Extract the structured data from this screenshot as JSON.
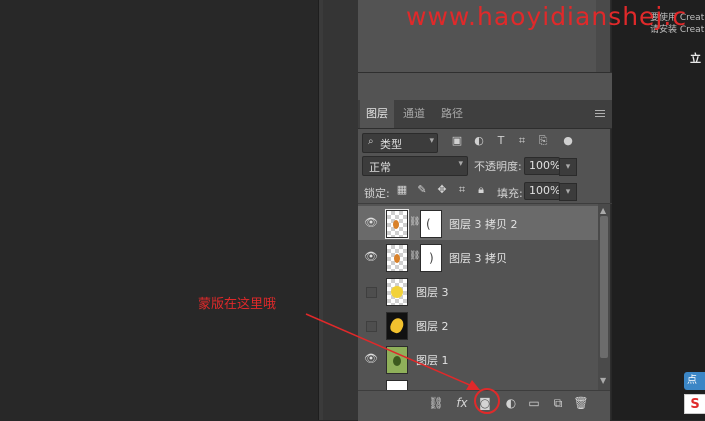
{
  "watermark": "www.haoyidianshej.c",
  "right_panel": {
    "line1": "要使用 Creat",
    "line2": "请安装 Creat",
    "line3": "立"
  },
  "layers_panel": {
    "tabs": [
      "图层",
      "通道",
      "路径"
    ],
    "filter": {
      "kind_label": "类型",
      "search_icon": "⌕"
    },
    "filter_icons": [
      "image-filter-icon",
      "adjustment-filter-icon",
      "type-filter-icon",
      "shape-filter-icon",
      "smart-object-filter-icon",
      "filter-toggle-icon"
    ],
    "blend_mode": "正常",
    "opacity_label": "不透明度:",
    "opacity_value": "100%",
    "lock_label": "锁定:",
    "lock_icons": [
      "lock-transparent-icon",
      "lock-paint-icon",
      "lock-move-icon",
      "lock-artboard-icon",
      "lock-all-icon"
    ],
    "fill_label": "填充:",
    "fill_value": "100%",
    "layers": [
      {
        "name": "图层 3 拷贝 2",
        "visible": true,
        "selected": true,
        "has_mask": true
      },
      {
        "name": "图层 3 拷贝",
        "visible": true,
        "selected": false,
        "has_mask": true
      },
      {
        "name": "图层 3",
        "visible": false,
        "selected": false,
        "has_mask": false
      },
      {
        "name": "图层 2",
        "visible": false,
        "selected": false,
        "has_mask": false
      },
      {
        "name": "图层 1",
        "visible": true,
        "selected": false,
        "has_mask": false
      }
    ],
    "bottom_icons": [
      "link-layers-icon",
      "fx-icon",
      "add-mask-icon",
      "adjustment-layer-icon",
      "group-folder-icon",
      "new-layer-icon",
      "delete-layer-icon"
    ]
  },
  "annotation": "蒙版在这里哦",
  "widgets": {
    "tip": "点",
    "sogou": "S"
  },
  "colors": {
    "annotation": "#e0292a",
    "panel_bg": "#535353",
    "selected_row": "#6a6a6a"
  }
}
